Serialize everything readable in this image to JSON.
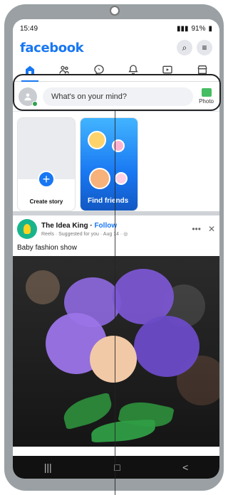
{
  "status": {
    "time": "15:49",
    "right_text": "91%"
  },
  "app": {
    "brand": "facebook",
    "brand_color": "#1877f2"
  },
  "icons": {
    "search": "search-icon",
    "menu": "menu-icon"
  },
  "composer": {
    "prompt": "What's on your mind?",
    "photo_label": "Photo"
  },
  "stories": {
    "create_label": "Create story",
    "find_friends_label": "Find friends"
  },
  "post": {
    "page_name": "The Idea King",
    "follow_label": "Follow",
    "subline": "Reels · Suggested for you · Aug 14 · ",
    "caption": "Baby fashion show"
  },
  "system_nav": {
    "recent": "|||",
    "home": "□",
    "back": "<"
  }
}
